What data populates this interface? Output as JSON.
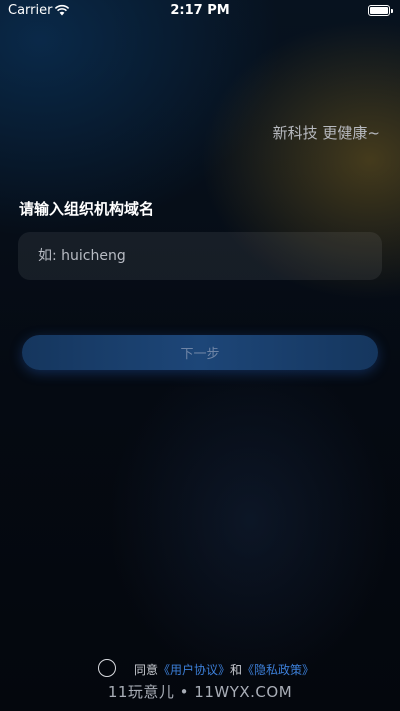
{
  "status_bar": {
    "carrier": "Carrier",
    "time": "2:17 PM"
  },
  "slogan": "新科技 更健康~",
  "form": {
    "label": "请输入组织机构域名",
    "input_value": "",
    "placeholder": "如: huicheng",
    "next_button": "下一步"
  },
  "agreement": {
    "prefix": "同意",
    "user_agreement": "《用户协议》",
    "conjunction": "和",
    "privacy_policy": "《隐私政策》"
  },
  "watermark": "11玩意儿 • 11WYX.COM",
  "colors": {
    "link": "#3c7fd8",
    "button": "#1d4678",
    "background": "#050a12"
  }
}
